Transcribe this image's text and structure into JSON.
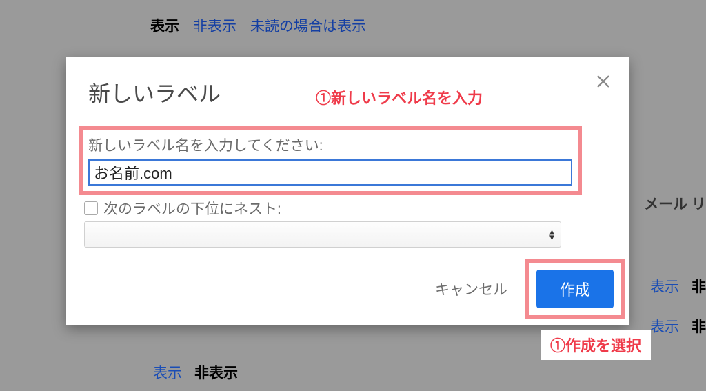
{
  "background": {
    "top": {
      "show": "表示",
      "hide": "非表示",
      "unread": "未読の場合は表示"
    },
    "mail": "メール リ",
    "rightLower": {
      "show": "表示",
      "hidePartial": "非"
    },
    "bottom": {
      "show": "表示",
      "hide": "非表示"
    }
  },
  "dialog": {
    "title": "新しいラベル",
    "inputLabel": "新しいラベル名を入力してください:",
    "inputValue": "お名前.com",
    "nestLabel": "次のラベルの下位にネスト:",
    "cancelLabel": "キャンセル",
    "createLabel": "作成"
  },
  "annotations": {
    "step1": "①新しいラベル名を入力",
    "step2": "①作成を選択"
  }
}
